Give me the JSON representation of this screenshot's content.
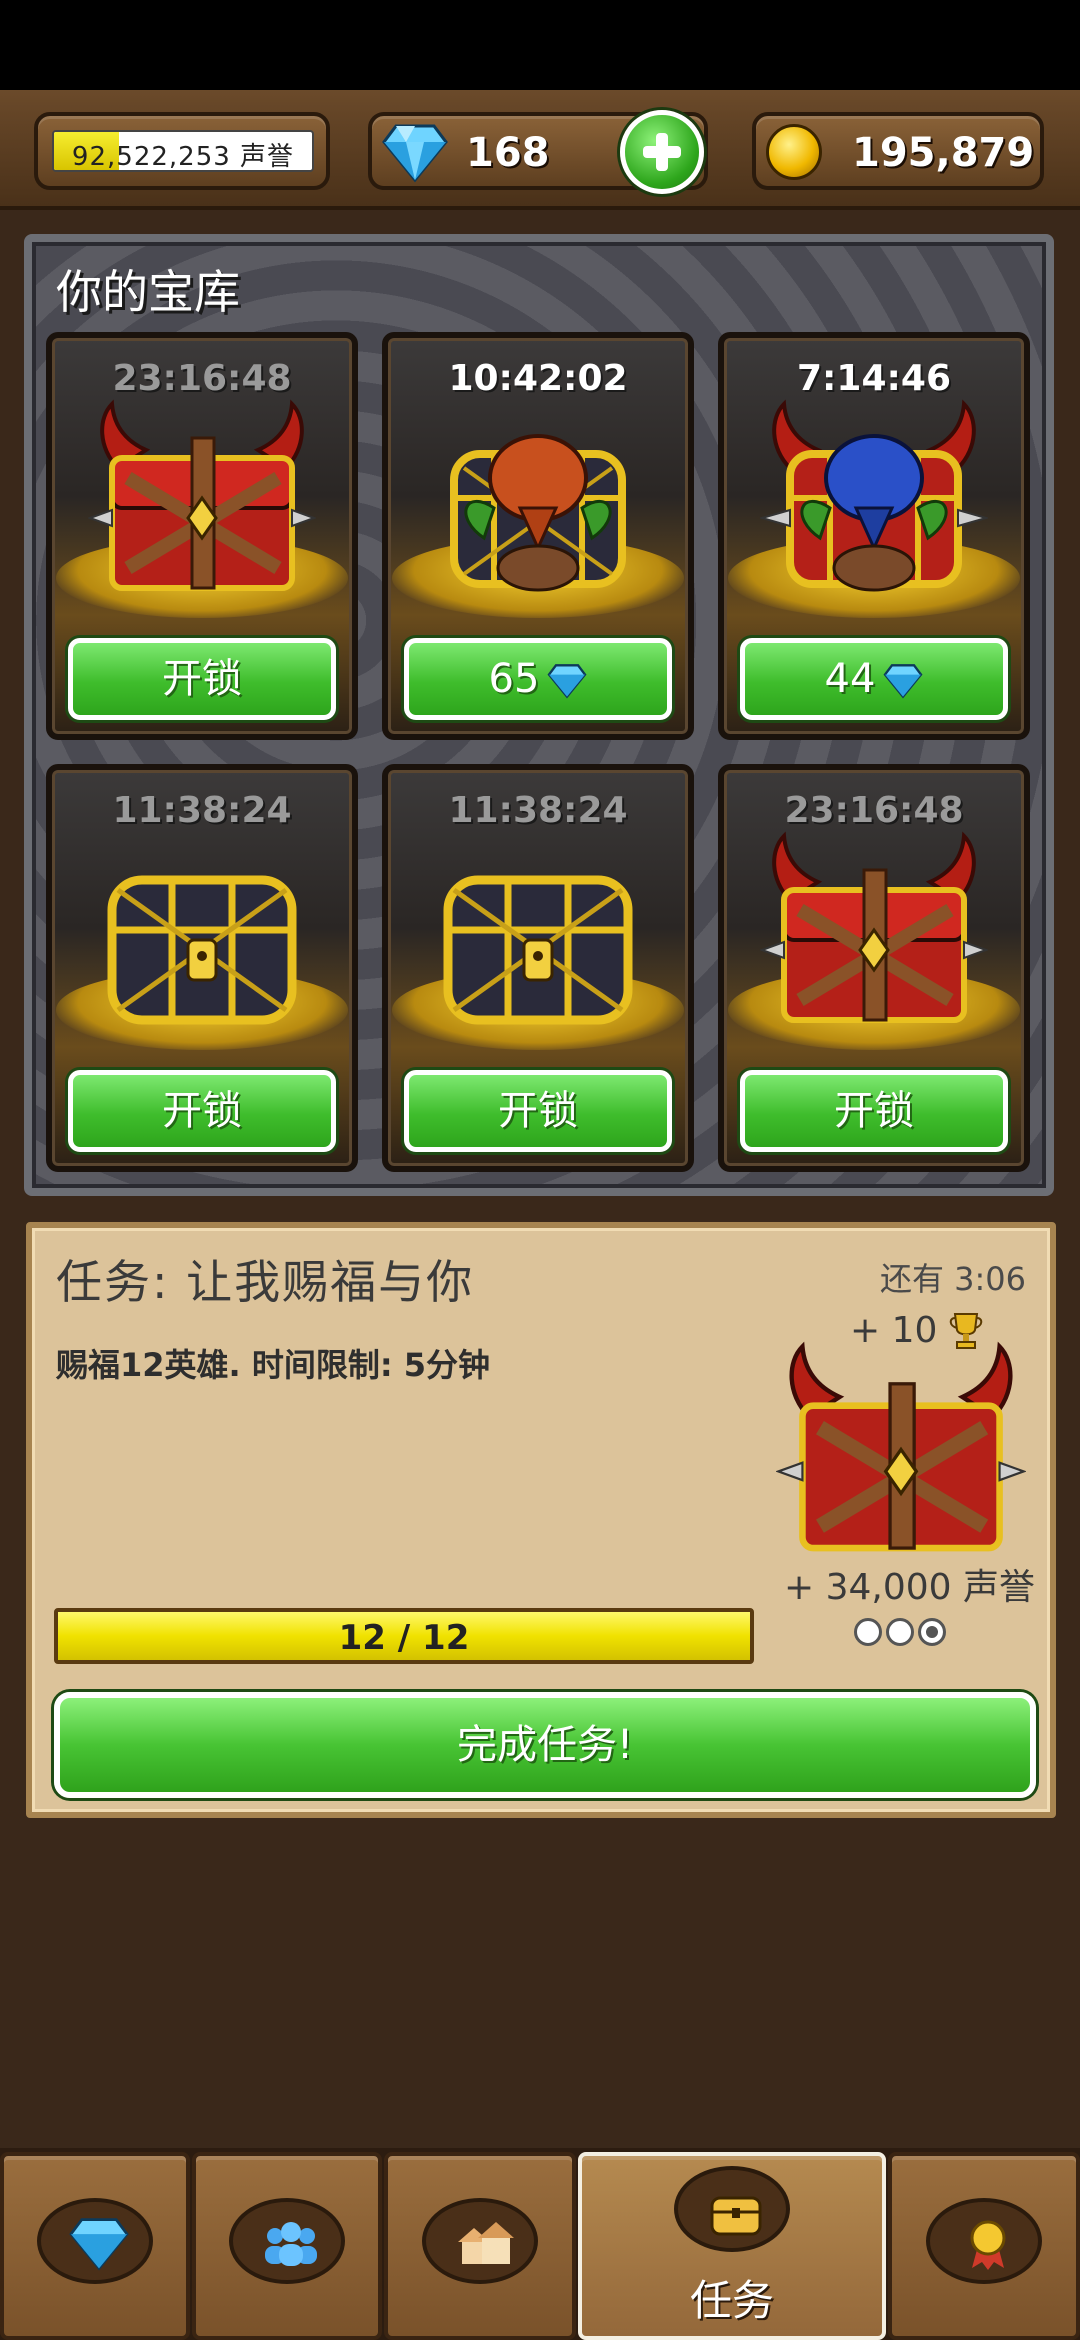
{
  "header": {
    "reputation_label": "92,522,253 声誉",
    "reputation_fill_fraction": 0.25,
    "gems": "168",
    "gold": "195,879"
  },
  "vault": {
    "title": "你的宝库",
    "cards": [
      {
        "timer": "23:16:48",
        "timer_style": "dim",
        "chest": "red-horned-chest",
        "button": "开锁",
        "gem_cost": false
      },
      {
        "timer": "10:42:02",
        "timer_style": "bright",
        "chest": "gold-cage-chest-red-hood",
        "button": "65",
        "gem_cost": true
      },
      {
        "timer": "7:14:46",
        "timer_style": "bright",
        "chest": "horned-cage-chest-blue-hood",
        "button": "44",
        "gem_cost": true
      },
      {
        "timer": "11:38:24",
        "timer_style": "dim",
        "chest": "gold-lattice-chest",
        "button": "开锁",
        "gem_cost": false
      },
      {
        "timer": "11:38:24",
        "timer_style": "dim",
        "chest": "gold-lattice-chest",
        "button": "开锁",
        "gem_cost": false
      },
      {
        "timer": "23:16:48",
        "timer_style": "dim",
        "chest": "red-horned-chest",
        "button": "开锁",
        "gem_cost": false
      }
    ]
  },
  "quest": {
    "title": "任务: 让我赐福与你",
    "time_left": "还有 3:06",
    "description": "赐福12英雄. 时间限制: 5分钟",
    "trophy_reward": "+ 10",
    "reputation_reward": "+ 34,000 声誉",
    "progress_text": "12 / 12",
    "progress_fraction": 1.0,
    "stars_filled": 1,
    "stars_total": 3,
    "complete_button": "完成任务!"
  },
  "bottom_nav": {
    "tabs": [
      {
        "icon": "gem-icon",
        "label": ""
      },
      {
        "icon": "heroes-icon",
        "label": ""
      },
      {
        "icon": "village-icon",
        "label": ""
      },
      {
        "icon": "chest-icon",
        "label": "任务",
        "active": true
      },
      {
        "icon": "medal-icon",
        "label": ""
      }
    ]
  },
  "colors": {
    "button_green": "#3fbd2c",
    "progress_yellow": "#f0e200",
    "wood_brown": "#7a522a"
  }
}
